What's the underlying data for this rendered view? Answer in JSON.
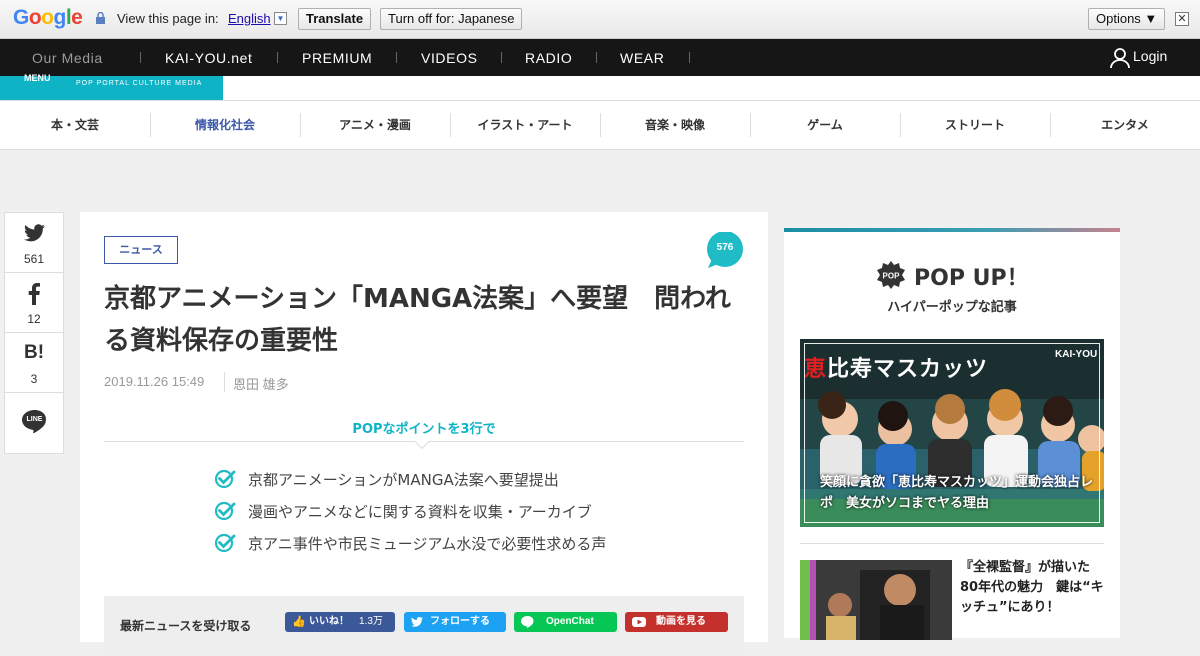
{
  "translate_bar": {
    "logo_letters": [
      "G",
      "o",
      "o",
      "g",
      "l",
      "e"
    ],
    "logo_colors": [
      "#4285f4",
      "#ea4335",
      "#fbbc05",
      "#4285f4",
      "#34a853",
      "#ea4335"
    ],
    "prompt": "View this page in:",
    "language": "English",
    "translate_label": "Translate",
    "turn_off_label": "Turn off for: Japanese",
    "options_label": "Options ▼",
    "close_glyph": "✕"
  },
  "media_bar": {
    "label": "Our Media",
    "items": [
      "KAI-YOU.net",
      "PREMIUM",
      "VIDEOS",
      "RADIO",
      "WEAR"
    ],
    "login": "Login"
  },
  "header": {
    "menu": "MENU",
    "tagline": "POP PORTAL CULTURE MEDIA",
    "accent": "#0fb3c6"
  },
  "categories": [
    "本・文芸",
    "情報化社会",
    "アニメ・漫画",
    "イラスト・アート",
    "音楽・映像",
    "ゲーム",
    "ストリート",
    "エンタメ"
  ],
  "share": {
    "twitter_count": "561",
    "facebook_count": "12",
    "hatena_label": "B!",
    "hatena_count": "3",
    "line_label": "LINE"
  },
  "article": {
    "tag": "ニュース",
    "comment_count": "576",
    "title": "京都アニメーション「MANGA法案」へ要望　問われる資料保存の重要性",
    "date": "2019.11.26 15:49",
    "author": "恩田 雄多",
    "points_heading": "POPなポイントを3行で",
    "points": [
      "京都アニメーションがMANGA法案へ要望提出",
      "漫画やアニメなどに関する資料を収集・アーカイブ",
      "京アニ事件や市民ミュージアム水没で必要性求める声"
    ]
  },
  "subscribe": {
    "label": "最新ニュースを受け取る",
    "facebook": "いいね！",
    "facebook_count": "1.3万",
    "twitter": "フォローする",
    "line": "OpenChat",
    "youtube": "動画を見る"
  },
  "sidebar": {
    "title": "POP UP！",
    "subtitle": "ハイパーポップな記事",
    "pop_badge": "POP",
    "featured": {
      "headline_red": "恵",
      "headline_rest": "比寿マスカッツ",
      "logo": "KAI-YOU",
      "caption": "笑顔に貪欲「恵比寿マスカッツ」運動会独占レポ　美女がソコまでヤる理由"
    },
    "second": {
      "title": "『全裸監督』が描いた80年代の魅力　鍵は“キッチュ”にあり！"
    }
  }
}
